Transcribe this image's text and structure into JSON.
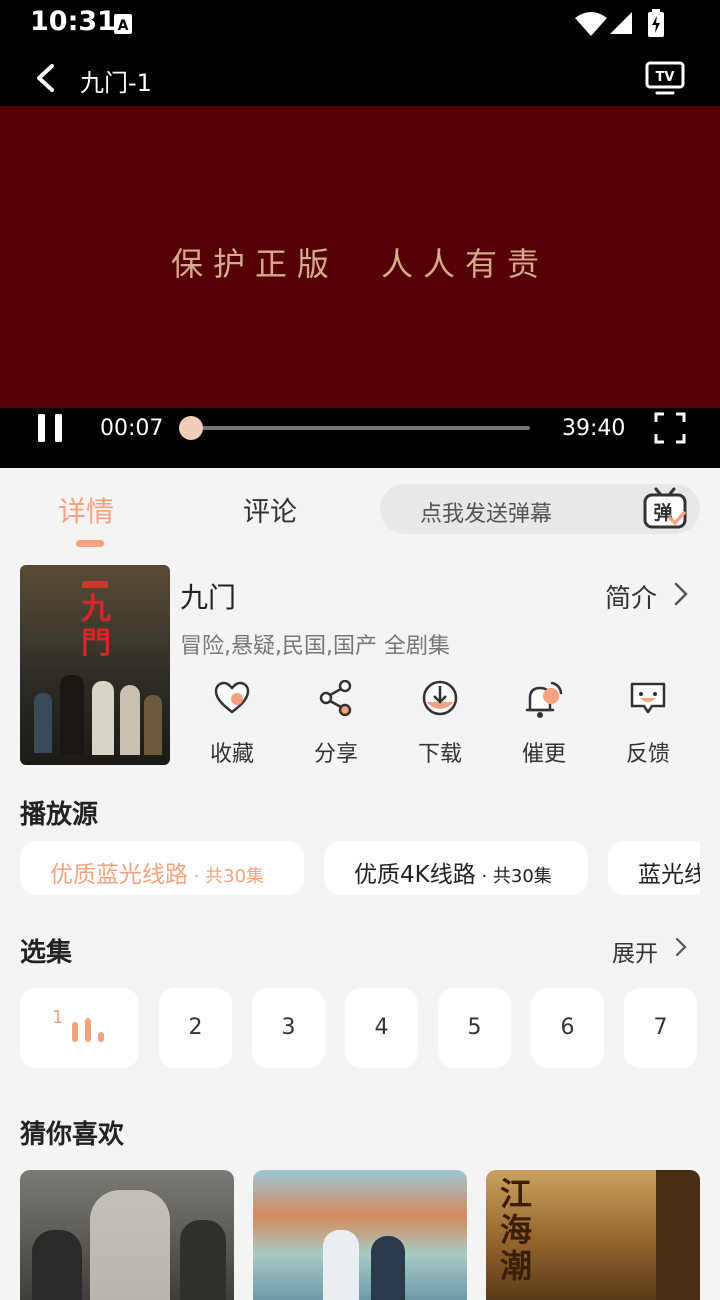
{
  "status_bar": {
    "time": "10:31"
  },
  "top_bar": {
    "title": "九门-1"
  },
  "video": {
    "slogan": "保护正版　人人有责"
  },
  "player": {
    "current_time": "00:07",
    "total_time": "39:40",
    "progress": 0.003
  },
  "tabs": {
    "detail": "详情",
    "comments": "评论"
  },
  "danmu": {
    "placeholder": "点我发送弹幕",
    "icon_text": "弹"
  },
  "show": {
    "poster_title": "九門",
    "title": "九门",
    "tags": "冒险,悬疑,民国,国产 全剧集",
    "intro_label": "简介"
  },
  "actions": [
    {
      "label": "收藏",
      "icon": "heart-icon"
    },
    {
      "label": "分享",
      "icon": "share-icon"
    },
    {
      "label": "下载",
      "icon": "download-icon"
    },
    {
      "label": "催更",
      "icon": "bell-icon"
    },
    {
      "label": "反馈",
      "icon": "feedback-icon"
    }
  ],
  "sources": {
    "title": "播放源",
    "items": [
      {
        "name": "优质蓝光线路",
        "count": " · 共30集",
        "selected": true
      },
      {
        "name": "优质4K线路",
        "count": " · 共30集",
        "selected": false
      },
      {
        "name": "蓝光线",
        "count": "",
        "selected": false
      }
    ]
  },
  "episodes": {
    "title": "选集",
    "expand_label": "展开",
    "items": [
      "1",
      "2",
      "3",
      "4",
      "5",
      "6",
      "7"
    ]
  },
  "recommend": {
    "title": "猜你喜欢",
    "items": [
      {
        "poster_text": ""
      },
      {
        "poster_text": ""
      },
      {
        "poster_text": "江海潮"
      }
    ]
  },
  "colors": {
    "accent": "#f4a380",
    "video_bg": "#540005",
    "page_bg": "#f4f4f4"
  }
}
